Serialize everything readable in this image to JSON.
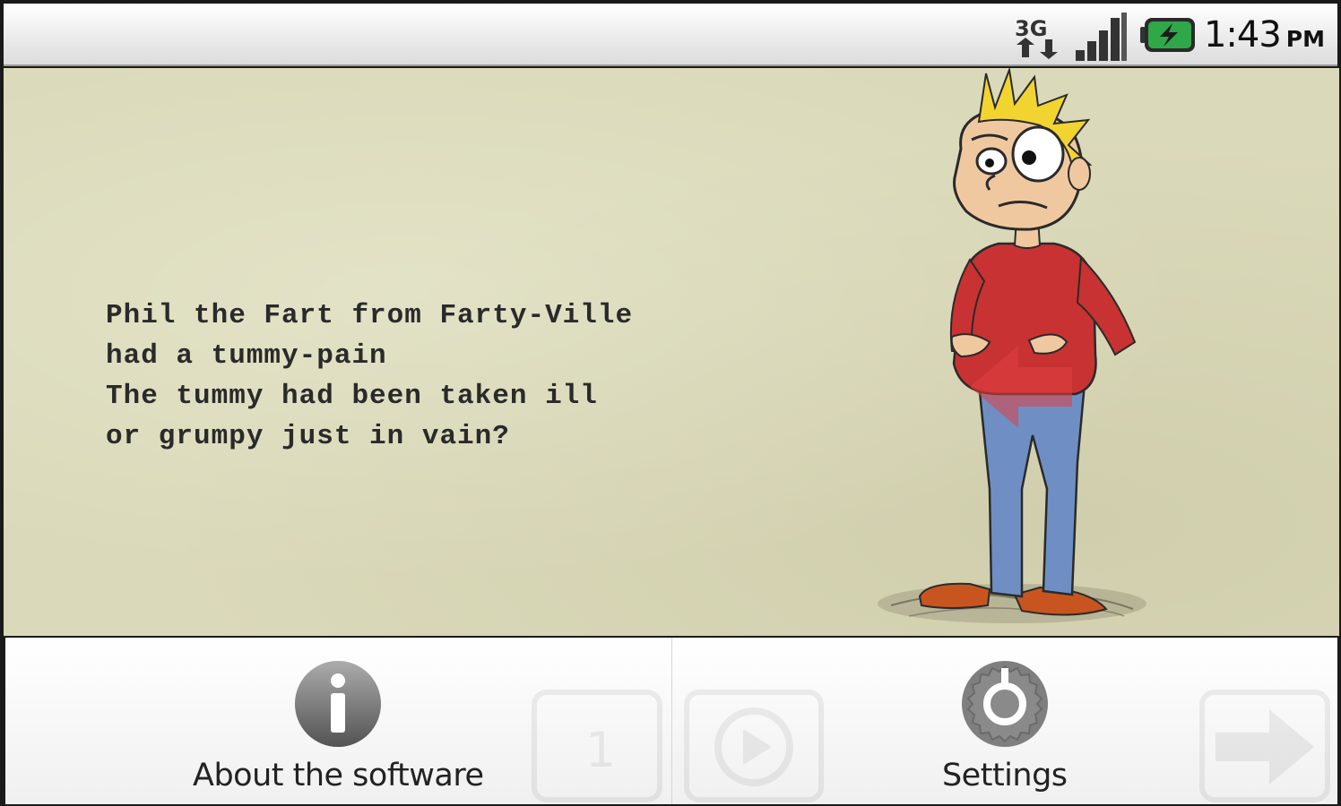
{
  "status_bar": {
    "network_label": "3G",
    "time": "1:43",
    "ampm": "PM",
    "icons": [
      "3g-data-icon",
      "signal-strength-icon",
      "battery-charging-icon"
    ]
  },
  "story": {
    "lines": [
      "Phil the Fart from Farty-Ville",
      "had a tummy-pain",
      "The tummy had been taken ill",
      "or grumpy just in vain?"
    ]
  },
  "menu": {
    "items": [
      {
        "label": "About the software",
        "icon": "info-icon"
      },
      {
        "label": "Settings",
        "icon": "settings-icon"
      }
    ]
  },
  "colors": {
    "page_bg": "#dad9b9",
    "text": "#2a2a2a",
    "menu_icon": "#7f7f7f"
  }
}
